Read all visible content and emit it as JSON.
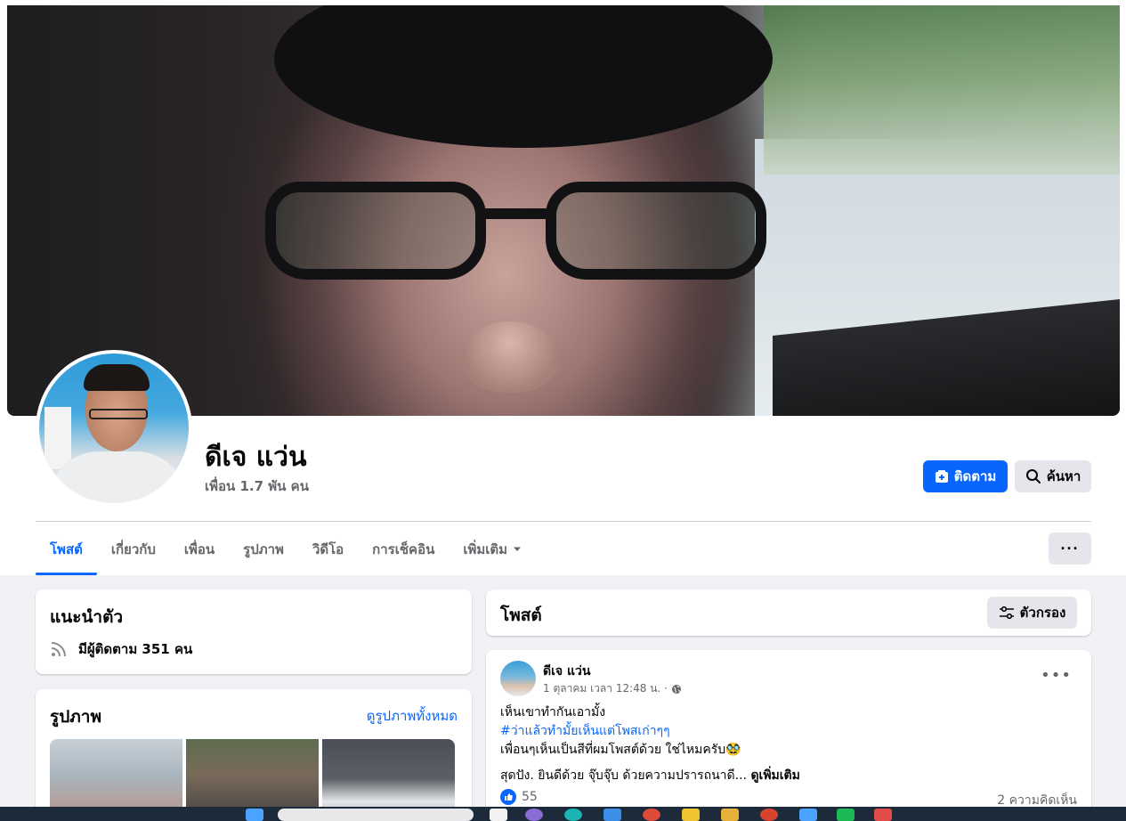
{
  "profile": {
    "name": "ดีเจ แว่น",
    "friends": "เพื่อน 1.7 พัน คน"
  },
  "actions": {
    "follow_label": "ติดตาม",
    "search_label": "ค้นหา",
    "more_label": "···"
  },
  "tabs": [
    {
      "label": "โพสต์",
      "active": true
    },
    {
      "label": "เกี่ยวกับ"
    },
    {
      "label": "เพื่อน"
    },
    {
      "label": "รูปภาพ"
    },
    {
      "label": "วิดีโอ"
    },
    {
      "label": "การเช็คอิน"
    },
    {
      "label": "เพิ่มเติม"
    }
  ],
  "intro": {
    "title": "แนะนำตัว",
    "followers": "มีผู้ติดตาม 351 คน"
  },
  "photos": {
    "title": "รูปภาพ",
    "see_all": "ดูรูปภาพทั้งหมด"
  },
  "posts": {
    "title": "โพสต์",
    "filter_label": "ตัวกรอง"
  },
  "post": {
    "author": "ดีเจ แว่น",
    "time": "1 ตุลาคม เวลา 12:48 น. ·",
    "line1": "เห็นเขาทำกันเอามั้ง",
    "hashtag": "#ว่าแล้วทำมั้ยเห็นแต่โพสเก่าๆๆ",
    "line3": "เพื่อนๆเห็นเป็นสีที่ผมโพสต์ด้วย ใช่ไหมครับ🥸",
    "line4": "สุดปัง. ยินดีด้วย จุ๊บจุ๊บ  ด้วยความปรารถนาดี...",
    "see_more": "ดูเพิ่มเติม",
    "likes": "55",
    "comments": "2 ความคิดเห็น"
  },
  "colors": {
    "accent": "#0866ff",
    "secondary_text": "#65676b",
    "button_gray": "#e4e6eb"
  }
}
